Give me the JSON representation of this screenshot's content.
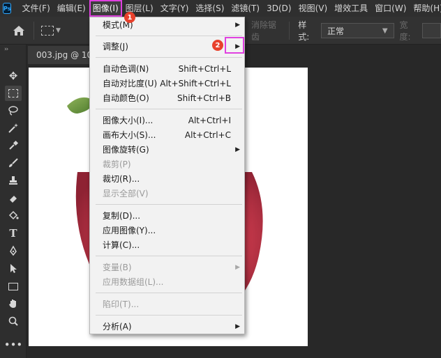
{
  "app": {
    "logo_text": "Ps"
  },
  "menubar": {
    "items": [
      {
        "label": "文件(F)"
      },
      {
        "label": "编辑(E)"
      },
      {
        "label": "图像(I)"
      },
      {
        "label": "图层(L)"
      },
      {
        "label": "文字(Y)"
      },
      {
        "label": "选择(S)"
      },
      {
        "label": "滤镜(T)"
      },
      {
        "label": "3D(D)"
      },
      {
        "label": "视图(V)"
      },
      {
        "label": "增效工具"
      },
      {
        "label": "窗口(W)"
      },
      {
        "label": "帮助(H)"
      }
    ],
    "active_index": 2
  },
  "options": {
    "antialias_label": "消除锯齿",
    "style_label": "样式:",
    "style_value": "正常",
    "width_label": "宽度:"
  },
  "document": {
    "tab_title": "003.jpg @ 10"
  },
  "dropdown": {
    "items": [
      {
        "label": "模式(M)",
        "shortcut": "",
        "submenu": true,
        "enabled": true
      },
      {
        "label": "调整(J)",
        "shortcut": "",
        "submenu": true,
        "enabled": true
      },
      {
        "label": "自动色调(N)",
        "shortcut": "Shift+Ctrl+L",
        "submenu": false,
        "enabled": true
      },
      {
        "label": "自动对比度(U)",
        "shortcut": "Alt+Shift+Ctrl+L",
        "submenu": false,
        "enabled": true
      },
      {
        "label": "自动颜色(O)",
        "shortcut": "Shift+Ctrl+B",
        "submenu": false,
        "enabled": true
      },
      {
        "label": "图像大小(I)...",
        "shortcut": "Alt+Ctrl+I",
        "submenu": false,
        "enabled": true
      },
      {
        "label": "画布大小(S)...",
        "shortcut": "Alt+Ctrl+C",
        "submenu": false,
        "enabled": true
      },
      {
        "label": "图像旋转(G)",
        "shortcut": "",
        "submenu": true,
        "enabled": true
      },
      {
        "label": "裁剪(P)",
        "shortcut": "",
        "submenu": false,
        "enabled": false
      },
      {
        "label": "裁切(R)...",
        "shortcut": "",
        "submenu": false,
        "enabled": true
      },
      {
        "label": "显示全部(V)",
        "shortcut": "",
        "submenu": false,
        "enabled": false
      },
      {
        "label": "复制(D)...",
        "shortcut": "",
        "submenu": false,
        "enabled": true
      },
      {
        "label": "应用图像(Y)...",
        "shortcut": "",
        "submenu": false,
        "enabled": true
      },
      {
        "label": "计算(C)...",
        "shortcut": "",
        "submenu": false,
        "enabled": true
      },
      {
        "label": "变量(B)",
        "shortcut": "",
        "submenu": true,
        "enabled": false
      },
      {
        "label": "应用数据组(L)...",
        "shortcut": "",
        "submenu": false,
        "enabled": false
      },
      {
        "label": "陷印(T)...",
        "shortcut": "",
        "submenu": false,
        "enabled": false
      },
      {
        "label": "分析(A)",
        "shortcut": "",
        "submenu": true,
        "enabled": true
      }
    ]
  },
  "annotations": {
    "badge1": "1",
    "badge2": "2"
  },
  "colors": {
    "highlight": "#e040e0",
    "badge": "#e8412c",
    "accent": "#31a8ff"
  }
}
